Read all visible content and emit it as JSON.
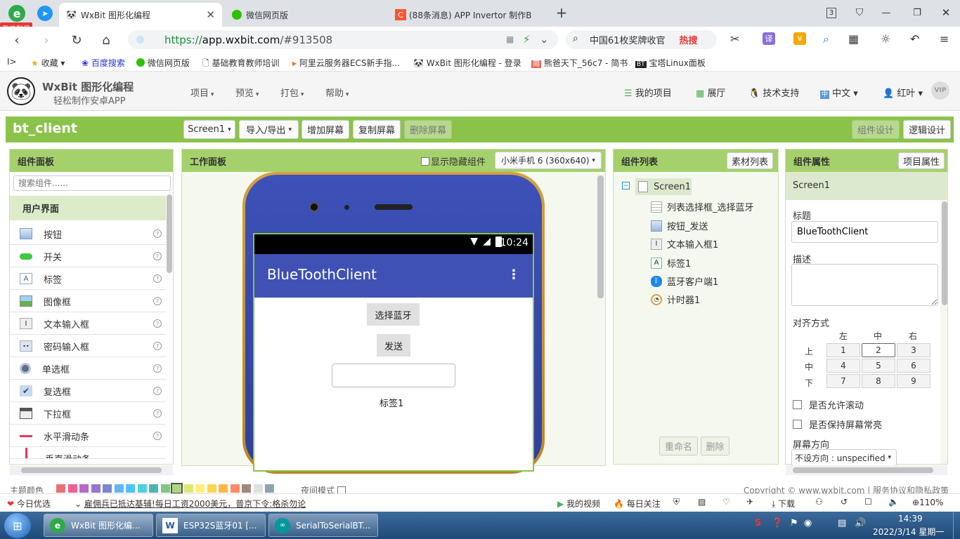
{
  "browser": {
    "login_badge": "登录账号",
    "tabs": [
      {
        "title": "WxBit 图形化编程"
      },
      {
        "title": "微信网页版"
      },
      {
        "title": "(88条消息) APP Invertor 制作B"
      }
    ],
    "tab_count": "3",
    "address": {
      "protocol": "https://",
      "host": "app.wxbit.com",
      "path": "/#913508"
    },
    "search": {
      "text": "中国61枚奖牌收官",
      "hot": "热搜"
    },
    "bookmarks": [
      "收藏",
      "百度搜索",
      "微信网页版",
      "基础教育教师培训",
      "阿里云服务器ECS新手指...",
      "WxBit 图形化编程 - 登录",
      "熊爸天下_56c7 - 简书",
      "宝塔Linux面板"
    ]
  },
  "app": {
    "logo_title": "WxBit 图形化编程",
    "logo_subtitle": "轻松制作安卓APP",
    "menus": [
      "项目",
      "预览",
      "打包",
      "帮助"
    ],
    "right_links": {
      "my_projects": "我的项目",
      "gallery": "展厅",
      "support": "技术支持",
      "language": "中文",
      "user": "红叶"
    },
    "project_name": "bt_client",
    "toolbar": {
      "screen_select": "Screen1",
      "import_export": "导入/导出",
      "add_screen": "增加屏幕",
      "copy_screen": "复制屏幕",
      "delete_screen": "删除屏幕",
      "designer": "组件设计",
      "blocks": "逻辑设计"
    },
    "palette": {
      "title": "组件面板",
      "search_placeholder": "搜索组件......",
      "category": "用户界面",
      "items": [
        "按钮",
        "开关",
        "标签",
        "图像框",
        "文本输入框",
        "密码输入框",
        "单选框",
        "复选框",
        "下拉框",
        "水平滑动条",
        "垂直滑动条"
      ]
    },
    "viewer": {
      "title": "工作面板",
      "show_hidden": "显示隐藏组件",
      "device": "小米手机 6 (360x640)",
      "phone": {
        "time": "10:24",
        "app_title": "BlueToothClient",
        "btn_select": "选择蓝牙",
        "btn_send": "发送",
        "label": "标签1"
      }
    },
    "components": {
      "title": "组件列表",
      "media_button": "素材列表",
      "root": "Screen1",
      "children": [
        "列表选择框_选择蓝牙",
        "按钮_发送",
        "文本输入框1",
        "标签1",
        "蓝牙客户端1",
        "计时器1"
      ],
      "rename": "重命名",
      "delete": "删除"
    },
    "properties": {
      "title": "组件属性",
      "project_button": "项目属性",
      "selected": "Screen1",
      "caption_label": "标题",
      "caption_value": "BlueToothClient",
      "desc_label": "描述",
      "align_label": "对齐方式",
      "col_headers": [
        "左",
        "中",
        "右"
      ],
      "row_headers": [
        "上",
        "中",
        "下"
      ],
      "grid": [
        "1",
        "2",
        "3",
        "4",
        "5",
        "6",
        "7",
        "8",
        "9"
      ],
      "selected_align": "2",
      "scroll_label": "是否允许滚动",
      "keep_on_label": "是否保持屏幕常亮",
      "orientation_label": "屏幕方向",
      "orientation_value": "不设方向 : unspecified"
    },
    "footer": {
      "theme_label": "主题颜色",
      "night_mode": "夜间模式",
      "copyright": "Copyright © www.wxbit.com | 服务协议和隐私政策"
    },
    "theme_colors": [
      "#e57373",
      "#f06292",
      "#ba68c8",
      "#9575cd",
      "#7986cb",
      "#64b5f6",
      "#4fc3f7",
      "#4dd0e1",
      "#4db6ac",
      "#81c784",
      "#aed581",
      "#dce775",
      "#fff176",
      "#ffd54f",
      "#ffb74d",
      "#ff8a65",
      "#a1887f",
      "#e0e0e0",
      "#90a4ae"
    ]
  },
  "statusbar": {
    "left1": "今日优选",
    "news": "雇佣兵已抵达基辅!每日工资2000美元，普京下令:格杀勿论",
    "video": "我的视频",
    "follow": "每日关注",
    "download": "下载",
    "zoom": "110%"
  },
  "taskbar": {
    "items": [
      "WxBit 图形化编...",
      "ESP32S蓝牙01 [...",
      "SerialToSerialBT..."
    ],
    "time": "14:39",
    "date": "2022/3/14 星期一"
  }
}
